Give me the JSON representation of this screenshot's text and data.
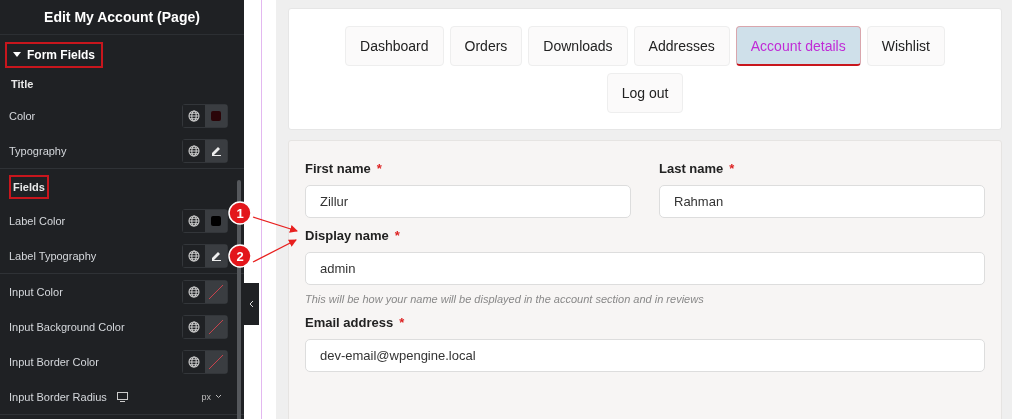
{
  "panel": {
    "title": "Edit My Account (Page)",
    "section": {
      "label": "Form Fields",
      "expanded": true,
      "highlighted": true
    },
    "groups": [
      {
        "heading": "Title",
        "highlighted": false,
        "controls": [
          {
            "label": "Color",
            "kind": "color",
            "color": "#2a0508"
          },
          {
            "label": "Typography",
            "kind": "typography"
          }
        ]
      },
      {
        "heading": "Fields",
        "highlighted": true,
        "controls": [
          {
            "label": "Label Color",
            "kind": "color",
            "color": "#000000"
          },
          {
            "label": "Label Typography",
            "kind": "typography"
          }
        ]
      },
      {
        "controls": [
          {
            "label": "Input Color",
            "kind": "unset"
          },
          {
            "label": "Input Background Color",
            "kind": "unset"
          },
          {
            "label": "Input Border Color",
            "kind": "unset"
          },
          {
            "label": "Input Border Radius",
            "kind": "units",
            "unit": "px"
          }
        ]
      }
    ]
  },
  "annotations": [
    {
      "number": "1"
    },
    {
      "number": "2"
    }
  ],
  "tabs": [
    {
      "label": "Dashboard",
      "selected": false
    },
    {
      "label": "Orders",
      "selected": false
    },
    {
      "label": "Downloads",
      "selected": false
    },
    {
      "label": "Addresses",
      "selected": false
    },
    {
      "label": "Account details",
      "selected": true
    },
    {
      "label": "Wishlist",
      "selected": false
    },
    {
      "label": "Log out",
      "selected": false
    }
  ],
  "form": {
    "rows": [
      [
        {
          "label": "First name",
          "required_mark": "*",
          "value": "Zillur"
        },
        {
          "label": "Last name",
          "required_mark": "*",
          "value": "Rahman"
        }
      ],
      [
        {
          "label": "Display name",
          "required_mark": "*",
          "value": "admin",
          "help": "This will be how your name will be displayed in the account section and in reviews"
        }
      ],
      [
        {
          "label": "Email address",
          "required_mark": "*",
          "value": "dev-email@wpengine.local"
        }
      ]
    ]
  }
}
